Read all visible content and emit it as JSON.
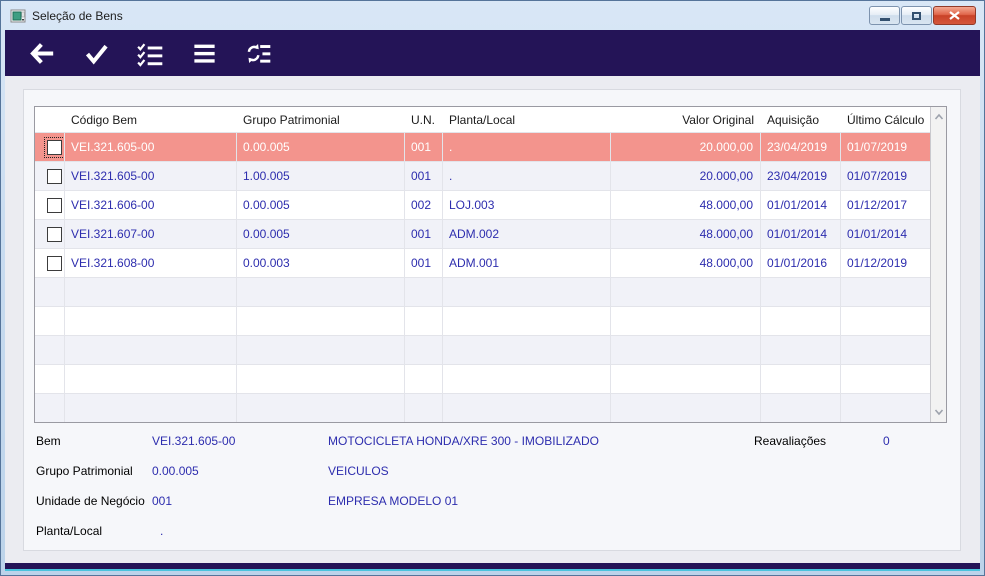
{
  "window": {
    "title": "Seleção de Bens",
    "controls": {
      "minimize": "minimize",
      "maximize": "maximize",
      "close": "close"
    }
  },
  "colors": {
    "toolbar_navy": "#241457",
    "selected_row": "#F3948D",
    "data_text_blue": "#2D2DAE",
    "alt_row": "#F1F2F8",
    "close_red": "#C94228",
    "titlebar_blue": "#C9DCF0"
  },
  "toolbar": {
    "buttons": [
      {
        "name": "back",
        "icon": "arrow-left-icon"
      },
      {
        "name": "confirm",
        "icon": "check-icon"
      },
      {
        "name": "checklist",
        "icon": "checklist-icon"
      },
      {
        "name": "list",
        "icon": "list-icon"
      },
      {
        "name": "refresh-list",
        "icon": "refresh-list-icon"
      }
    ]
  },
  "table": {
    "headers": [
      "",
      "Código Bem",
      "Grupo Patrimonial",
      "U.N.",
      "Planta/Local",
      "Valor Original",
      "Aquisição",
      "Último Cálculo"
    ],
    "rows": [
      {
        "selected": true,
        "checked": false,
        "codigo": "VEI.321.605-00",
        "grupo": "0.00.005",
        "un": "001",
        "planta": ".",
        "valor": "20.000,00",
        "aquisicao": "23/04/2019",
        "ultimo": "01/07/2019"
      },
      {
        "selected": false,
        "checked": false,
        "codigo": "VEI.321.605-00",
        "grupo": "1.00.005",
        "un": "001",
        "planta": ".",
        "valor": "20.000,00",
        "aquisicao": "23/04/2019",
        "ultimo": "01/07/2019"
      },
      {
        "selected": false,
        "checked": false,
        "codigo": "VEI.321.606-00",
        "grupo": "0.00.005",
        "un": "002",
        "planta": "LOJ.003",
        "valor": "48.000,00",
        "aquisicao": "01/01/2014",
        "ultimo": "01/12/2017"
      },
      {
        "selected": false,
        "checked": false,
        "codigo": "VEI.321.607-00",
        "grupo": "0.00.005",
        "un": "001",
        "planta": "ADM.002",
        "valor": "48.000,00",
        "aquisicao": "01/01/2014",
        "ultimo": "01/01/2014"
      },
      {
        "selected": false,
        "checked": false,
        "codigo": "VEI.321.608-00",
        "grupo": "0.00.003",
        "un": "001",
        "planta": "ADM.001",
        "valor": "48.000,00",
        "aquisicao": "01/01/2016",
        "ultimo": "01/12/2019"
      }
    ],
    "empty_rows": 5
  },
  "details": {
    "rows": [
      {
        "label": "Bem",
        "value": "VEI.321.605-00",
        "desc": "MOTOCICLETA HONDA/XRE 300 - IMOBILIZADO"
      },
      {
        "label": "Grupo Patrimonial",
        "value": "0.00.005",
        "desc": "VEICULOS"
      },
      {
        "label": "Unidade de Negócio",
        "value": "001",
        "desc": "EMPRESA MODELO 01"
      },
      {
        "label": "Planta/Local",
        "value": ".",
        "desc": ""
      }
    ],
    "reavaliacoes_label": "Reavaliações",
    "reavaliacoes_value": "0"
  }
}
